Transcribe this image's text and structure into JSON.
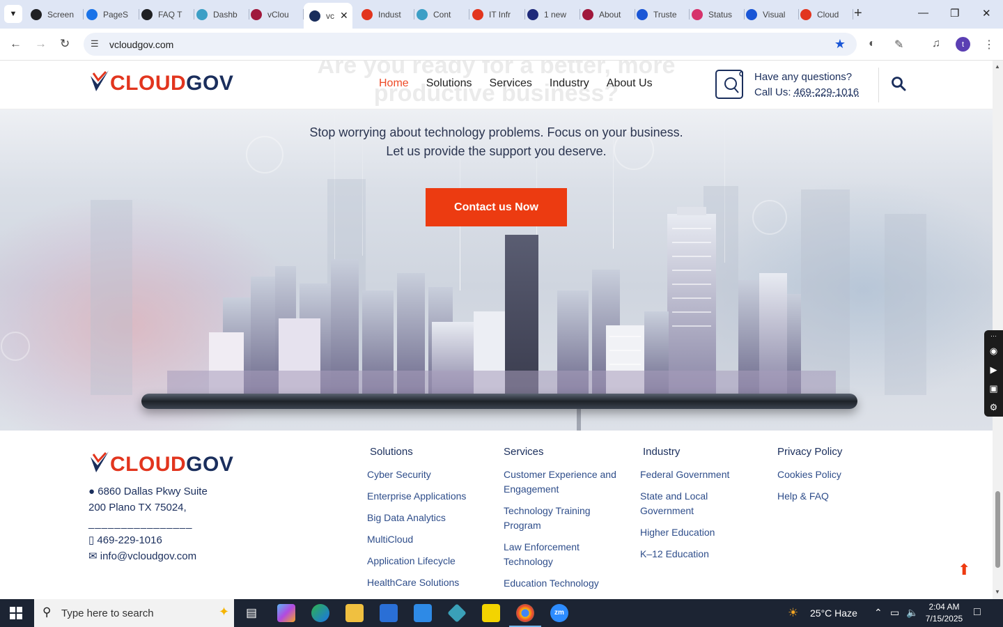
{
  "browser": {
    "tabs": [
      {
        "label": "Screen",
        "color": "#202124"
      },
      {
        "label": "PageS",
        "color": "#1a73e8"
      },
      {
        "label": "FAQ T",
        "color": "#202124"
      },
      {
        "label": "Dashb",
        "color": "#3c9fc6"
      },
      {
        "label": "vClou",
        "color": "#a0183c"
      },
      {
        "label": "vc",
        "color": "#1a2e5c"
      },
      {
        "label": "Indust",
        "color": "#e2351e"
      },
      {
        "label": "Cont",
        "color": "#3c9fc6"
      },
      {
        "label": "IT Infr",
        "color": "#e2351e"
      },
      {
        "label": "1 new",
        "color": "#1f2a7a"
      },
      {
        "label": "About",
        "color": "#a0183c"
      },
      {
        "label": "Truste",
        "color": "#1a56d6"
      },
      {
        "label": "Status",
        "color": "#d6336c"
      },
      {
        "label": "Visual",
        "color": "#1a56d6"
      },
      {
        "label": "Cloud",
        "color": "#e2351e"
      }
    ],
    "url": "vcloudgov.com",
    "profile_initial": "t"
  },
  "header": {
    "logo": {
      "part1": "CLOUD",
      "part2": "GOV"
    },
    "ghost_heading_line1": "Are you ready for a better, more",
    "ghost_heading_line2": "productive business?",
    "nav": [
      "Home",
      "Solutions",
      "Services",
      "Industry",
      "About Us"
    ],
    "contact_question": "Have any questions?",
    "contact_call_prefix": "Call Us: ",
    "contact_phone": "469-229-1016"
  },
  "hero": {
    "line1": "Stop worrying about technology problems. Focus on your business.",
    "line2": "Let us provide the support you deserve.",
    "cta_label": "Contact us Now"
  },
  "footer": {
    "address_line1": "6860 Dallas Pkwy Suite",
    "address_line2": "200 Plano TX 75024,",
    "divider": "________________",
    "phone": "469-229-1016",
    "email": "info@vcloudgov.com",
    "columns": [
      {
        "title": "Solutions",
        "links": [
          "Cyber Security",
          "Enterprise Applications",
          "Big Data Analytics",
          "MultiCloud",
          "Application Lifecycle",
          "HealthCare Solutions"
        ]
      },
      {
        "title": "Services",
        "links": [
          "Customer Experience and Engagement",
          "Technology Training Program",
          "Law Enforcement Technology",
          "Education Technology"
        ]
      },
      {
        "title": "Industry",
        "links": [
          "Federal Government",
          "State and Local Government",
          "Higher Education",
          "K–12 Education"
        ]
      },
      {
        "title": "Privacy Policy",
        "links": [
          "Cookies Policy",
          "Help & FAQ"
        ]
      }
    ]
  },
  "taskbar": {
    "search_placeholder": "Type here to search",
    "weather": "25°C  Haze",
    "time": "2:04 AM",
    "date": "7/15/2025"
  },
  "colors": {
    "accent": "#ec3b11",
    "brand_navy": "#1a2e5c",
    "link": "#2e4d8a"
  }
}
